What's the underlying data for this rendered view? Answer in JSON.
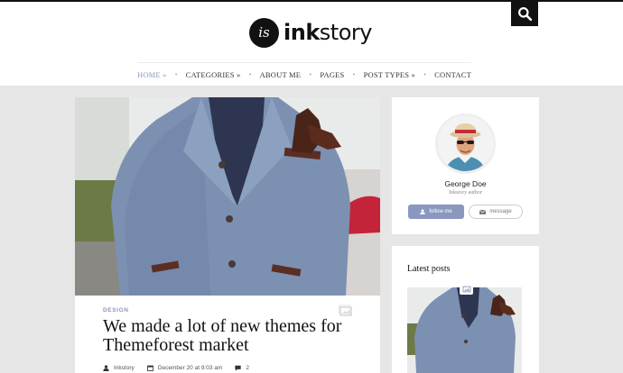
{
  "brand": {
    "badge": "is",
    "name_bold": "ink",
    "name_rest": "story"
  },
  "header": {
    "search_icon": "search-icon"
  },
  "nav": {
    "items": [
      {
        "label": "HOME",
        "arrow": "»",
        "active": true
      },
      {
        "label": "CATEGORIES",
        "arrow": "»",
        "active": false
      },
      {
        "label": "ABOUT ME",
        "arrow": "",
        "active": false
      },
      {
        "label": "PAGES",
        "arrow": "",
        "active": false
      },
      {
        "label": "POST TYPES",
        "arrow": "»",
        "active": false
      },
      {
        "label": "CONTACT",
        "arrow": "",
        "active": false
      }
    ],
    "separator": "•"
  },
  "post": {
    "category": "DESIGN",
    "title": "We made a lot of new themes for Themeforest market",
    "author": "Inkstory",
    "date": "December 20 at 9:03 am",
    "comments": "2",
    "format_icon": "photo-icon"
  },
  "author_widget": {
    "name": "George Doe",
    "role": "Inkstory author",
    "follow_label": "follow me",
    "message_label": "message"
  },
  "latest_widget": {
    "title": "Latest posts"
  },
  "colors": {
    "accent": "#8a98bf",
    "page_bg": "#e6e6e6",
    "header_bar": "#111111"
  }
}
